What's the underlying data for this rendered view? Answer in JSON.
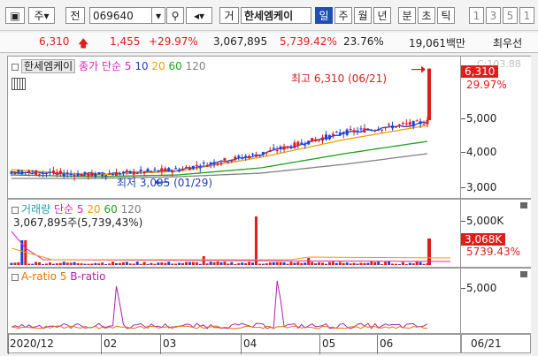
{
  "toolbar": {
    "type_label": "주",
    "currency_label": "전",
    "code": "069640",
    "name_tab": "거",
    "stock_name": "한세엠케이",
    "periods": [
      "일",
      "주",
      "월",
      "년",
      "분",
      "초",
      "틱"
    ],
    "selected_period": "일",
    "intervals": [
      "1",
      "3",
      "5",
      "1"
    ]
  },
  "quote": {
    "price": "6,310",
    "change": "1,455",
    "change_pct": "+29.97%",
    "volume": "3,067,895",
    "volume_pct": "5,739.42%",
    "turnover": "23.76%",
    "amount": "19,061백만",
    "broker": "최우선"
  },
  "price_pane": {
    "title": "한세엠케이",
    "ma_label": "종가 단순",
    "ma_periods": [
      "5",
      "10",
      "20",
      "60",
      "120"
    ],
    "ma_colors": [
      "#e020c0",
      "#2040e0",
      "#f0a000",
      "#20a020",
      "#808080"
    ],
    "high_label": "최고 6,310 (06/21)",
    "low_label": "최저 3,095 (01/29)",
    "axis_labels": [
      "5,000",
      "4,000",
      "3,000"
    ],
    "price_box": "6,310",
    "pct_box": "29.97%",
    "top_faint": "C:103.88"
  },
  "volume_pane": {
    "title": "거래량",
    "ma_label": "단순",
    "ma_periods": [
      "5",
      "20",
      "60",
      "120"
    ],
    "info": "3,067,895주(5,739,43%)",
    "axis_label": "5,000K",
    "vol_box": "3,068K",
    "pct_box": "5739.43%"
  },
  "ratio_pane": {
    "a_label": "A-ratio 5",
    "b_label": "B-ratio",
    "axis_label": "5,000"
  },
  "x_axis": {
    "labels": [
      "2020/12",
      "02",
      "03",
      "04",
      "05",
      "06"
    ],
    "current_date": "06/21"
  },
  "chart_data": {
    "type": "line",
    "x": [
      "2020/12",
      "02",
      "03",
      "04",
      "05",
      "06"
    ],
    "series": [
      {
        "name": "종가",
        "values": [
          3400,
          3300,
          3450,
          3900,
          4500,
          4800,
          6310
        ]
      },
      {
        "name": "5",
        "values": [
          3380,
          3320,
          3430,
          3880,
          4480,
          4780,
          5100
        ]
      },
      {
        "name": "20",
        "values": [
          3450,
          3300,
          3400,
          3800,
          4300,
          4700,
          4850
        ]
      },
      {
        "name": "60",
        "values": [
          3300,
          3250,
          3300,
          3500,
          3900,
          4250,
          4450
        ]
      },
      {
        "name": "120",
        "values": [
          3200,
          3200,
          3250,
          3350,
          3600,
          3900,
          4050
        ]
      }
    ],
    "high": 6310,
    "low": 3095,
    "ylim": [
      2800,
      6500
    ]
  }
}
